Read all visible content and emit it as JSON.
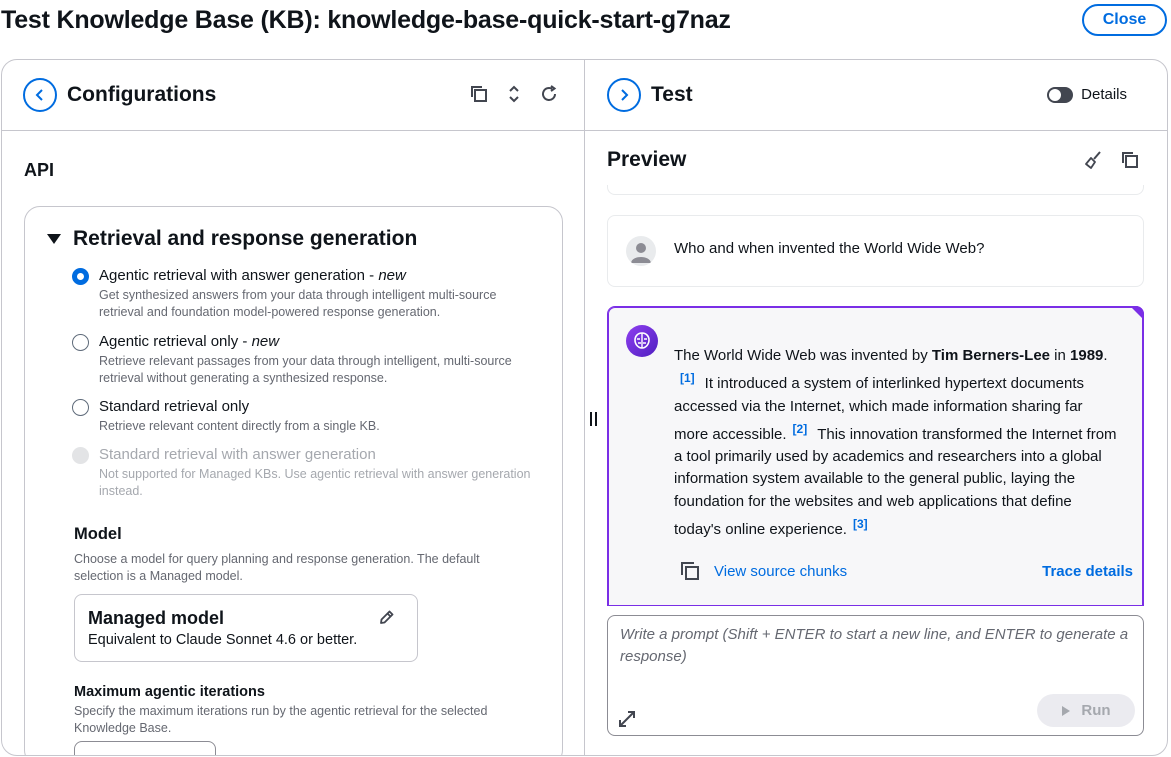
{
  "page": {
    "title": "Test Knowledge Base (KB): knowledge-base-quick-start-g7naz",
    "close_label": "Close"
  },
  "config": {
    "title": "Configurations",
    "api_label": "API",
    "section_title": "Retrieval and response generation",
    "options": [
      {
        "label": "Agentic retrieval with answer generation - ",
        "tag": "new",
        "desc": "Get synthesized answers from your data through intelligent multi-source retrieval and foundation model-powered response generation.",
        "state": "checked"
      },
      {
        "label": "Agentic retrieval only - ",
        "tag": "new",
        "desc": "Retrieve relevant passages from your data through intelligent, multi-source retrieval without generating a synthesized response.",
        "state": "unchecked"
      },
      {
        "label": "Standard retrieval only",
        "tag": "",
        "desc": "Retrieve relevant content directly from a single KB.",
        "state": "unchecked"
      },
      {
        "label": "Standard retrieval with answer generation",
        "tag": "",
        "desc": "Not supported for Managed KBs. Use agentic retrieval with answer generation instead.",
        "state": "disabled"
      }
    ],
    "model_heading": "Model",
    "model_desc": "Choose a model for query planning and response generation. The default selection is a Managed model.",
    "model_name": "Managed model",
    "model_sub": "Equivalent to Claude Sonnet 4.6 or better.",
    "iter_heading": "Maximum agentic iterations",
    "iter_desc": "Specify the maximum iterations run by the agentic retrieval for the selected Knowledge Base."
  },
  "test": {
    "title": "Test",
    "details_label": "Details",
    "details_on": false,
    "preview_title": "Preview",
    "user_question": "Who and when invented the World Wide Web?",
    "answer": {
      "p1": "The World Wide Web was invented by ",
      "name": "Tim Berners-Lee",
      "p2": " in ",
      "year": "1989",
      "p3": ".",
      "c1": "[1]",
      "p4": "It introduced a system of interlinked hypertext documents accessed via the Internet, which made information sharing far more accessible.",
      "c2": "[2]",
      "p5": "This innovation transformed the Internet from a tool primarily used by academics and researchers into a global information system available to the general public, laying the foundation for the websites and web applications that define today's online experience.",
      "c3": "[3]"
    },
    "view_sources": "View source chunks",
    "trace_details": "Trace details",
    "prompt_placeholder": "Write a prompt (Shift + ENTER to start a new line, and ENTER to generate a response)",
    "run_label": "Run"
  },
  "colors": {
    "accent": "#006ce0",
    "ai_border": "#7a2ee6"
  }
}
